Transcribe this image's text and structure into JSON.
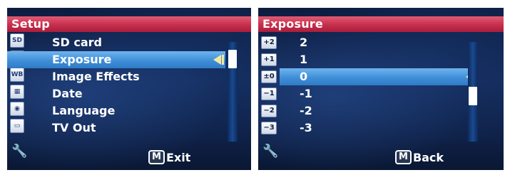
{
  "left_screen": {
    "title": "Setup",
    "icons": [
      {
        "name": "sd-card-icon",
        "glyph": "SD"
      },
      {
        "name": "exposure-icon",
        "glyph": "+/-"
      },
      {
        "name": "white-balance-icon",
        "glyph": "WB"
      },
      {
        "name": "calendar-icon",
        "glyph": "▦"
      },
      {
        "name": "language-icon",
        "glyph": "◉"
      },
      {
        "name": "tv-icon",
        "glyph": "▭"
      }
    ],
    "menu_items": [
      "SD card",
      "Exposure",
      "Image Effects",
      "Date",
      "Language",
      "TV Out"
    ],
    "selected_index": 1,
    "scroll_position": 0.1,
    "softkey": {
      "badge": "M",
      "label": "Exit"
    }
  },
  "right_screen": {
    "title": "Exposure",
    "rows": [
      {
        "icon": "+2",
        "value": "2"
      },
      {
        "icon": "+1",
        "value": "1"
      },
      {
        "icon": "±0",
        "value": "0"
      },
      {
        "icon": "−1",
        "value": "-1"
      },
      {
        "icon": "−2",
        "value": "-2"
      },
      {
        "icon": "−3",
        "value": "-3"
      }
    ],
    "selected_index": 2,
    "scroll_position": 0.55,
    "softkey": {
      "badge": "M",
      "label": "Back"
    }
  },
  "colors": {
    "title_bar": "#c62e4c",
    "highlight": "#3f8fd8",
    "background": "#142a58"
  }
}
